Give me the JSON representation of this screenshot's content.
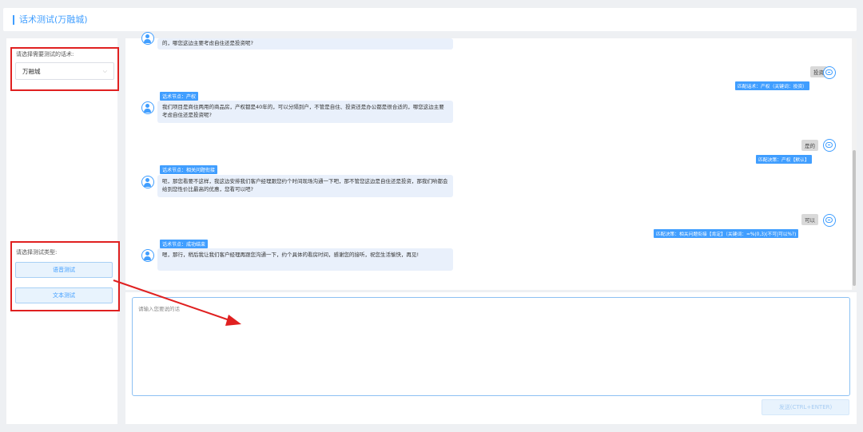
{
  "header": {
    "title": "话术测试(万融城)"
  },
  "left": {
    "script_label": "请选择需要测试的话术:",
    "script_value": "万融城",
    "type_label": "请选择测试类型:",
    "voice_btn": "语音测试",
    "text_btn": "文本测试"
  },
  "chat": {
    "top_bubble": "的，哪您这边主要考虑自住还是投资呢?",
    "user1": {
      "reply": "投资",
      "match": "匹配话术：产权（关键词：投资）"
    },
    "bot1": {
      "tag": "话术节点：产权",
      "text": "我们项目是商住两用的商品房，产权都是40年的，可以分隔到户，不管是自住、投资还是办公都是很合适的，哪您这边主要考虑自住还是投资呢?"
    },
    "user2": {
      "reply": "是的",
      "match": "匹配决策：产权【默认】"
    },
    "bot2": {
      "tag": "话术节点：相关问题衔接",
      "text": "呃，那您看要不这样，我这边安排我们客户经理跟您约个时间现场沟通一下吧，那不管您这边是自住还是投资，那我们哟都会给到您性价比最高的优惠，您看可以吧?"
    },
    "user3": {
      "reply": "可以",
      "match": "匹配决策：相关问题衔接【肯定】（关键词：=%(0,3)(不可|可以%?)"
    },
    "bot3": {
      "tag": "话术节点：成功结束",
      "text": "嗯，那行，稍后我让我们客户经理再跟您沟通一下，约个具体的看房时间，感谢您的接听，祝您生活愉快，再见!"
    }
  },
  "input": {
    "placeholder": "请输入您要说的话",
    "send": "发送(CTRL+ENTER)"
  },
  "colors": {
    "accent": "#409eff",
    "annotation": "#e02020"
  }
}
